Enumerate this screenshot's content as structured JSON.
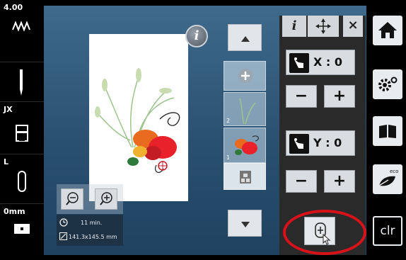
{
  "left_bar": {
    "stitch_width": "4.00",
    "presser_foot": "JX",
    "hoop_size": "L",
    "thread_tension": "0mm"
  },
  "stage": {
    "info_label": "i",
    "status": {
      "time": "11 min.",
      "dimensions": "141.3x145.5 mm"
    }
  },
  "panel": {
    "tab_info": "i",
    "close_label": "×",
    "x_label": "X : 0",
    "y_label": "Y : 0",
    "minus": "−",
    "plus": "+"
  },
  "layers": {
    "items": [
      "",
      "2",
      "1"
    ]
  },
  "right_bar": {
    "clr_label": "clr"
  },
  "colors": {
    "highlight": "#d7121b",
    "stage_blue": "#2a5070",
    "panel_dark": "#2a2a2a"
  }
}
